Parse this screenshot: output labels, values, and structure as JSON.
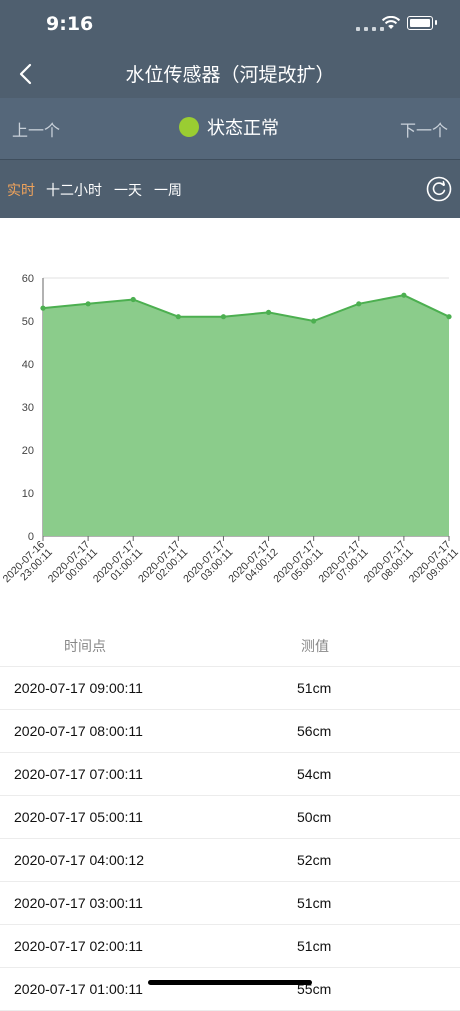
{
  "status_bar": {
    "time": "9:16"
  },
  "header": {
    "title": "水位传感器（河堤改扩）"
  },
  "nav": {
    "prev": "上一个",
    "next": "下一个",
    "state": "状态正常",
    "state_color": "#9acd32"
  },
  "tabs": [
    {
      "label": "实时",
      "active": true
    },
    {
      "label": "十二小时",
      "active": false
    },
    {
      "label": "一天",
      "active": false
    },
    {
      "label": "一周",
      "active": false
    }
  ],
  "colors": {
    "header_bg": "#4f5f6f",
    "accent": "#f0a35b",
    "series_line": "#4caf50",
    "series_fill": "#8bcc8b"
  },
  "chart_data": {
    "type": "area",
    "x": [
      "2020-07-16 23:00:11",
      "2020-07-17 00:00:11",
      "2020-07-17 01:00:11",
      "2020-07-17 02:00:11",
      "2020-07-17 03:00:11",
      "2020-07-17 04:00:12",
      "2020-07-17 05:00:11",
      "2020-07-17 07:00:11",
      "2020-07-17 08:00:11",
      "2020-07-17 09:00:11"
    ],
    "x_tick_lines": [
      [
        "2020-07-16",
        "23:00:11"
      ],
      [
        "2020-07-17",
        "00:00:11"
      ],
      [
        "2020-07-17",
        "01:00:11"
      ],
      [
        "2020-07-17",
        "02:00:11"
      ],
      [
        "2020-07-17",
        "03:00:11"
      ],
      [
        "2020-07-17",
        "04:00:12"
      ],
      [
        "2020-07-17",
        "05:00:11"
      ],
      [
        "2020-07-17",
        "07:00:11"
      ],
      [
        "2020-07-17",
        "08:00:11"
      ],
      [
        "2020-07-17",
        "09:00:11"
      ]
    ],
    "series": [
      {
        "values": [
          53,
          54,
          55,
          51,
          51,
          52,
          50,
          54,
          56,
          51
        ]
      }
    ],
    "ylim": [
      0,
      60
    ],
    "y_ticks": [
      0,
      10,
      20,
      30,
      40,
      50,
      60
    ],
    "grid": true
  },
  "table": {
    "headers": {
      "time": "时间点",
      "value": "测值"
    },
    "rows": [
      {
        "time": "2020-07-17 09:00:11",
        "value": "51cm"
      },
      {
        "time": "2020-07-17 08:00:11",
        "value": "56cm"
      },
      {
        "time": "2020-07-17 07:00:11",
        "value": "54cm"
      },
      {
        "time": "2020-07-17 05:00:11",
        "value": "50cm"
      },
      {
        "time": "2020-07-17 04:00:12",
        "value": "52cm"
      },
      {
        "time": "2020-07-17 03:00:11",
        "value": "51cm"
      },
      {
        "time": "2020-07-17 02:00:11",
        "value": "51cm"
      },
      {
        "time": "2020-07-17 01:00:11",
        "value": "55cm"
      }
    ]
  },
  "icons": {
    "back": "chevron-left-icon",
    "refresh": "refresh-icon",
    "wifi": "wifi-icon",
    "battery": "battery-icon"
  }
}
